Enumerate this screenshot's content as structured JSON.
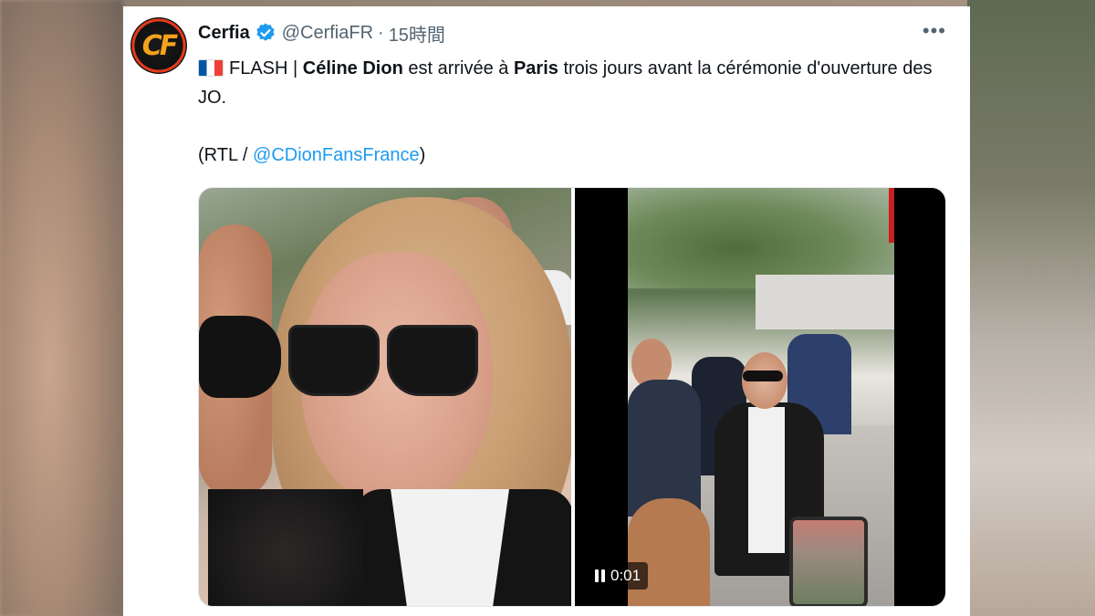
{
  "tweet": {
    "display_name": "Cerfia",
    "handle": "@CerfiaFR",
    "separator": "·",
    "time": "15時間",
    "more_icon": "more-dots-icon",
    "avatar_text": "CF",
    "body": {
      "prefix": "FLASH | ",
      "name": "Céline Dion",
      "mid": " est arrivée à ",
      "city": "Paris",
      "suffix": " trois jours avant la cérémonie d'ouverture des JO."
    },
    "credit_open": "(RTL / ",
    "credit_link": "@CDionFansFrance",
    "credit_close": ")",
    "video_time": "0:01"
  },
  "colors": {
    "link": "#1d9bf0",
    "verified": "#1d9bf0",
    "text": "#0f1419",
    "muted": "#536471"
  }
}
